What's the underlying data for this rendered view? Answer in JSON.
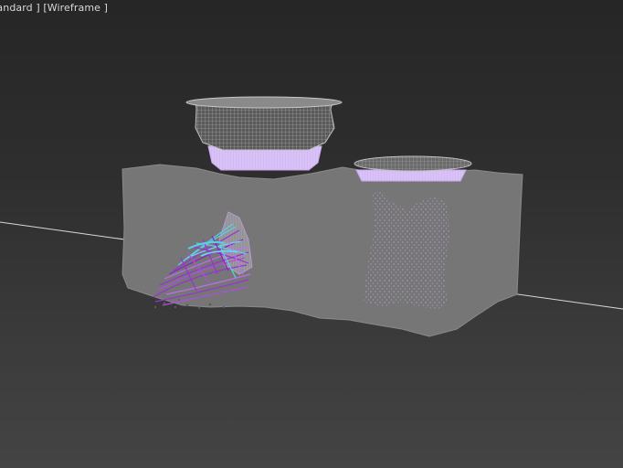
{
  "viewport": {
    "label_standard": "tandard ]",
    "label_wireframe": "[Wireframe ]",
    "background_top": "#262626",
    "background_bottom": "#444444"
  },
  "scene": {
    "ground_line_color": "#d0d0d0",
    "mesh_color": "#757575",
    "wire_color": "#b8b8b8",
    "vase_rim_color": "#c9a8f0",
    "particle_colors": [
      "#9b30d9",
      "#5ad0e8",
      "#c26cf5"
    ]
  }
}
